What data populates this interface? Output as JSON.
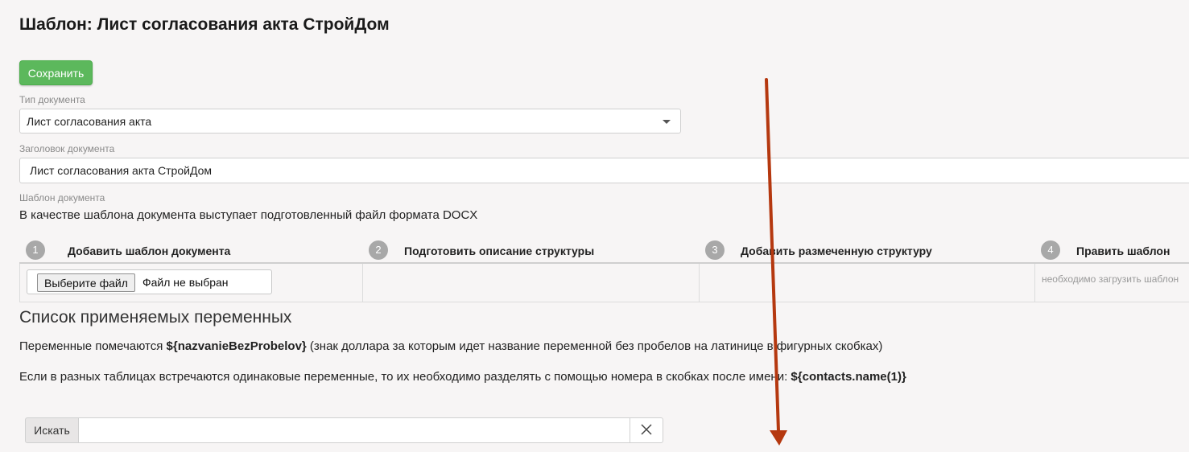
{
  "page": {
    "title": "Шаблон: Лист согласования акта СтройДом",
    "save_label": "Сохранить"
  },
  "fields": {
    "doc_type_label": "Тип документа",
    "doc_type_value": "Лист согласования акта",
    "doc_title_label": "Заголовок документа",
    "doc_title_value": "Лист согласования акта СтройДом",
    "template_label": "Шаблон документа",
    "template_desc": "В качестве шаблона документа выступает подготовленный файл формата DOCX"
  },
  "steps": [
    {
      "num": "1",
      "label": "Добавить шаблон документа"
    },
    {
      "num": "2",
      "label": "Подготовить описание структуры"
    },
    {
      "num": "3",
      "label": "Добавить размеченную структуру"
    },
    {
      "num": "4",
      "label": "Править шаблон"
    }
  ],
  "file": {
    "button_label": "Выберите файл",
    "status": "Файл не выбран"
  },
  "step4_hint": "необходимо загрузить шаблон",
  "variables": {
    "heading": "Список применяемых переменных",
    "p1_prefix": "Переменные помечаются ",
    "p1_code": "${nazvanieBezProbelov}",
    "p1_suffix": " (знак доллара за которым идет название переменной без пробелов на латинице в фигурных скобках)",
    "p2_prefix": "Если в разных таблицах встречаются одинаковые переменные, то их необходимо разделять с помощью номера в скобках после имени: ",
    "p2_code": "${contacts.name(1)}"
  },
  "search": {
    "label": "Искать",
    "value": ""
  },
  "colors": {
    "save_button": "#5cb85c",
    "annotation_arrow": "#b5380f"
  },
  "icons": {
    "dropdown": "chevron-down-icon",
    "clear": "close-icon",
    "annotation": "arrow-down-icon"
  }
}
